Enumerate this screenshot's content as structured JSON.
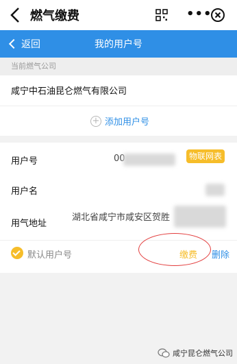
{
  "topbar": {
    "title": "燃气缴费",
    "more": "•••"
  },
  "navbar": {
    "back_label": "返回",
    "title": "我的用户号"
  },
  "section": {
    "current_company_label": "当前燃气公司"
  },
  "company": {
    "name": "咸宁中石油昆仑燃气有限公司",
    "add_user_label": "添加用户号"
  },
  "account": {
    "user_no_label": "用户号",
    "user_no_prefix": "00",
    "badge": "物联网表",
    "user_name_label": "用户名",
    "address_label": "用气地址",
    "address_value": "湖北省咸宁市咸安区贺胜",
    "default_label": "默认用户号",
    "pay_label": "缴费",
    "delete_label": "删除"
  },
  "watermark": {
    "text": "咸宁昆仑燃气公司"
  }
}
